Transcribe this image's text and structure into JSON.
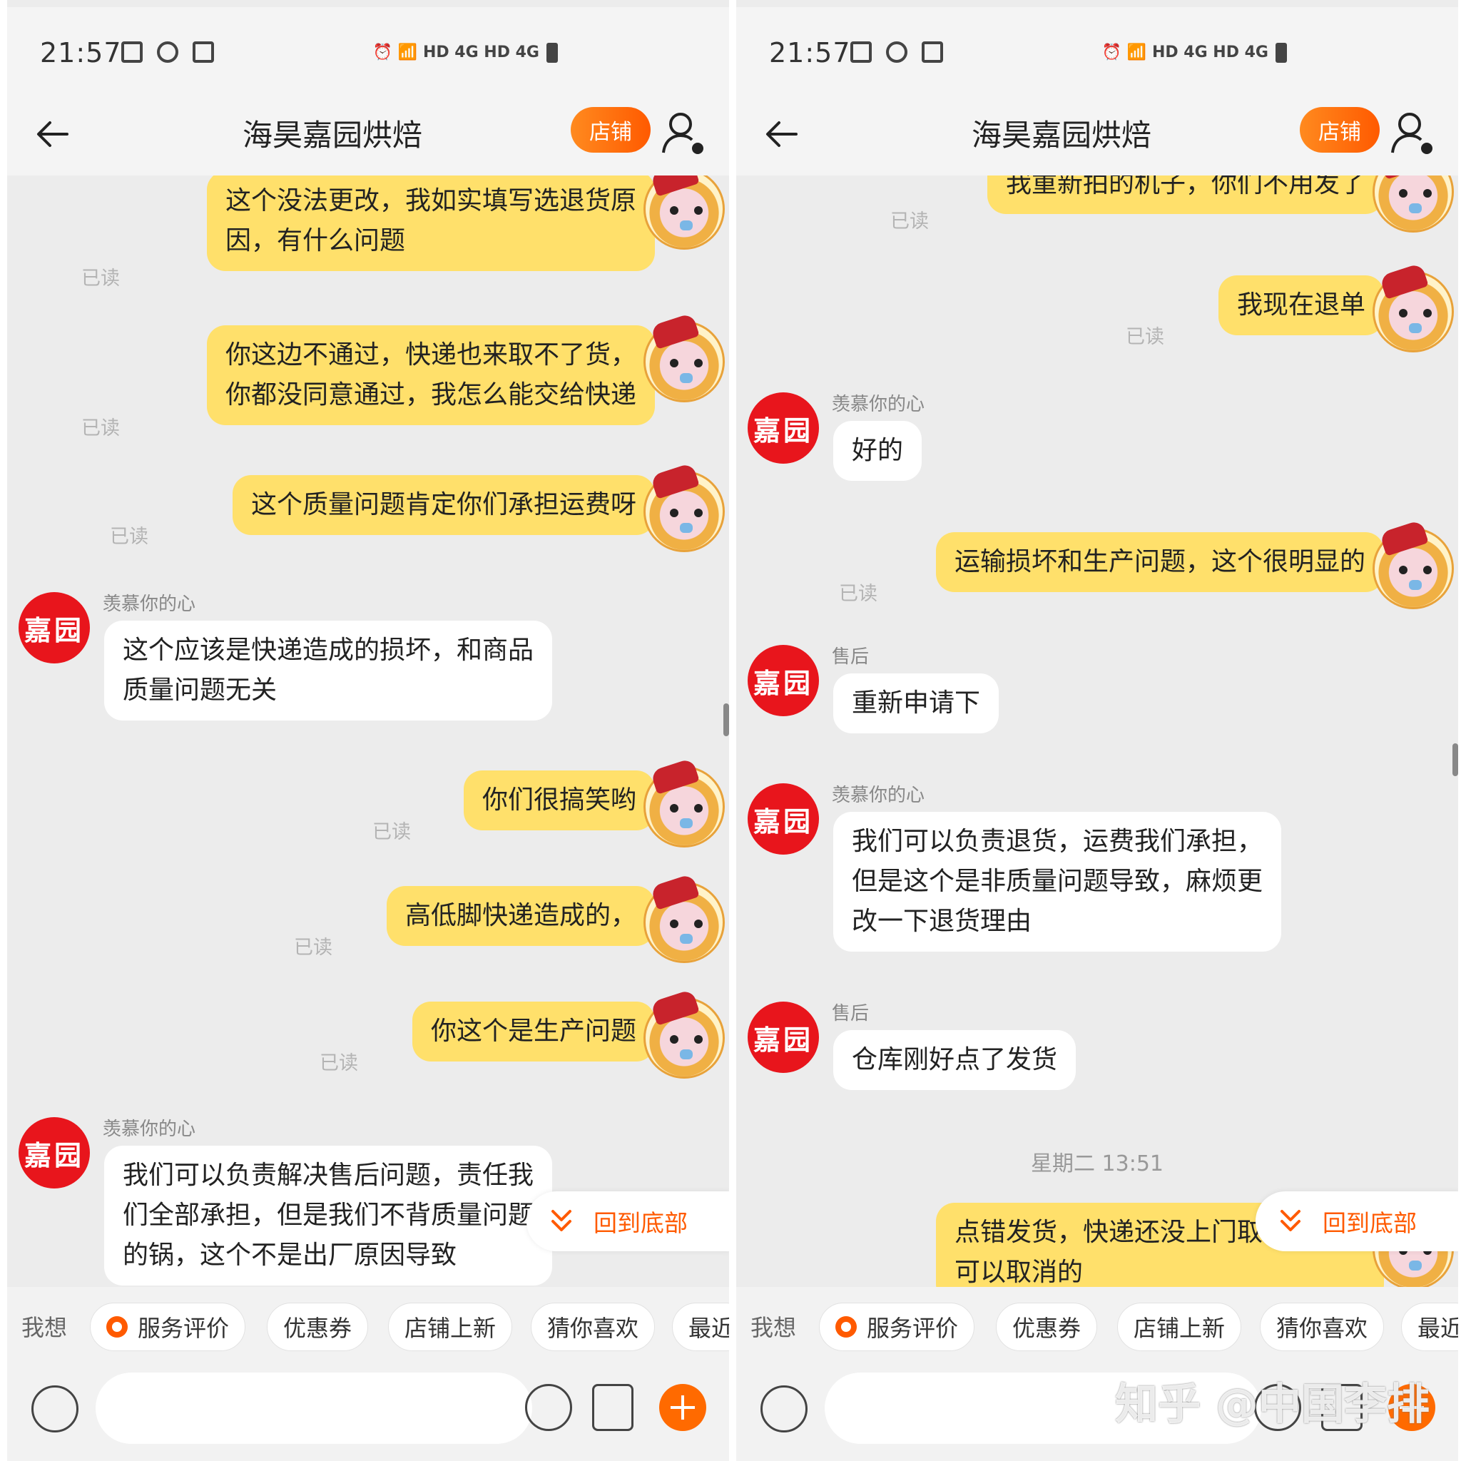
{
  "status_bar": {
    "time": "21:57",
    "network": "HD 4G HD 4G"
  },
  "header": {
    "title": "海昊嘉园烘焙",
    "shop_button": "店铺"
  },
  "avatar_text": "嘉园",
  "left": {
    "messages": [
      {
        "text_lines": [
          "这个没法更改，我如实填写选退货原",
          "因，有什么问题"
        ],
        "read": "已读"
      },
      {
        "text_lines": [
          "你这边不通过，快递也来取不了货，",
          "你都没同意通过，我怎么能交给快递"
        ],
        "read": "已读"
      },
      {
        "text": "这个质量问题肯定你们承担运费呀",
        "read": "已读"
      },
      {
        "sender": "羡慕你的心",
        "text_lines": [
          "这个应该是快递造成的损坏，和商品",
          "质量问题无关"
        ]
      },
      {
        "text": "你们很搞笑哟",
        "read": "已读"
      },
      {
        "text": "高低脚快递造成的，",
        "read": "已读"
      },
      {
        "text": "你这个是生产问题",
        "read": "已读"
      },
      {
        "sender": "羡慕你的心",
        "text_lines": [
          "我们可以负责解决售后问题，责任我",
          "们全部承担，但是我们不背质量问题",
          "的锅，这个不是出厂原因导致"
        ]
      }
    ],
    "back_to_bottom": "回到底部"
  },
  "right": {
    "messages": [
      {
        "text": "我重新拍的机子，你们不用发了",
        "read": "已读"
      },
      {
        "text": "我现在退单",
        "read": "已读"
      },
      {
        "sender": "羡慕你的心",
        "text": "好的"
      },
      {
        "text": "运输损坏和生产问题，这个很明显的",
        "read": "已读"
      },
      {
        "sender": "售后",
        "text": "重新申请下"
      },
      {
        "sender": "羡慕你的心",
        "text_lines": [
          "我们可以负责退货，运费我们承担，",
          "但是这个是非质量问题导致，麻烦更",
          "改一下退货理由"
        ]
      },
      {
        "sender": "售后",
        "text": "仓库刚好点了发货"
      },
      {
        "text_lines": [
          "点错发货，快递还没上门取件，你们",
          "可以取消的"
        ]
      }
    ],
    "timestamp": "星期二 13:51",
    "back_to_bottom": "回到底部"
  },
  "quick_bar": {
    "label": "我想",
    "chips": [
      "服务评价",
      "优惠券",
      "店铺上新",
      "猜你喜欢",
      "最近"
    ]
  },
  "watermark": "知乎 @中国李排",
  "colors": {
    "accent": "#ff5a00",
    "my_bubble": "#ffe06b",
    "shop_avatar": "#e8151c",
    "chat_bg": "#ececec"
  },
  "icons": [
    "back-arrow-icon",
    "user-settings-icon",
    "voice-icon",
    "emoji-icon",
    "shopping-bag-icon",
    "plus-icon",
    "chevron-double-down-icon"
  ]
}
